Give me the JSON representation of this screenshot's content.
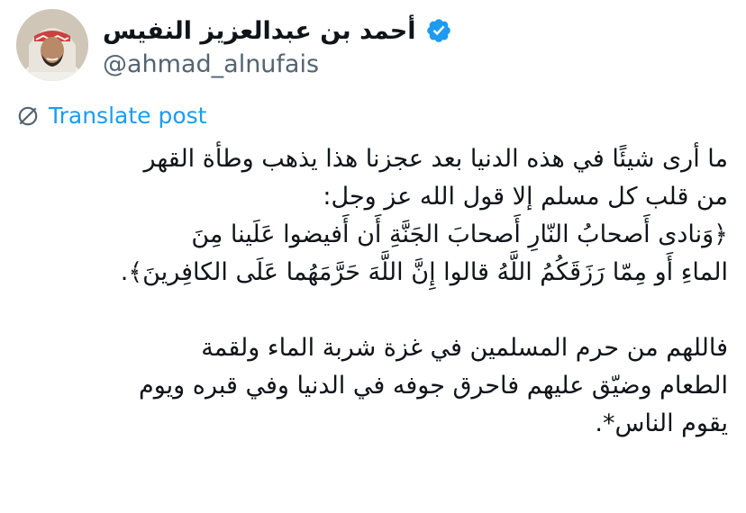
{
  "author": {
    "display_name": "أحمد بن عبدالعزيز النفيس",
    "handle": "@ahmad_alnufais",
    "verified_icon": "verified-badge-icon",
    "verified_color": "#1d9bf0"
  },
  "translate": {
    "label": "Translate post",
    "icon": "globe-icon",
    "color": "#1d9bf0"
  },
  "post": {
    "lines": [
      "ما أرى شيئًا في هذه الدنيا بعد عجزنا هذا يذهب وطأة القهر",
      "من قلب كل مسلم إلا قول الله عز وجل:",
      "﴿وَنادى أَصحابُ النّارِ أَصحابَ الجَنَّةِ أَن أَفيضوا عَلَينا مِنَ",
      "الماءِ أَو مِمّا رَزَقَكُمُ اللَّهُ قالوا إِنَّ اللَّهَ حَرَّمَهُما عَلَى الكافِرينَ﴾.",
      "",
      "فاللهم من حرم المسلمين في غزة شربة الماء ولقمة",
      "الطعام وضيّق عليهم فاحرق جوفه في الدنيا وفي قبره ويوم",
      "يقوم الناس*."
    ]
  }
}
